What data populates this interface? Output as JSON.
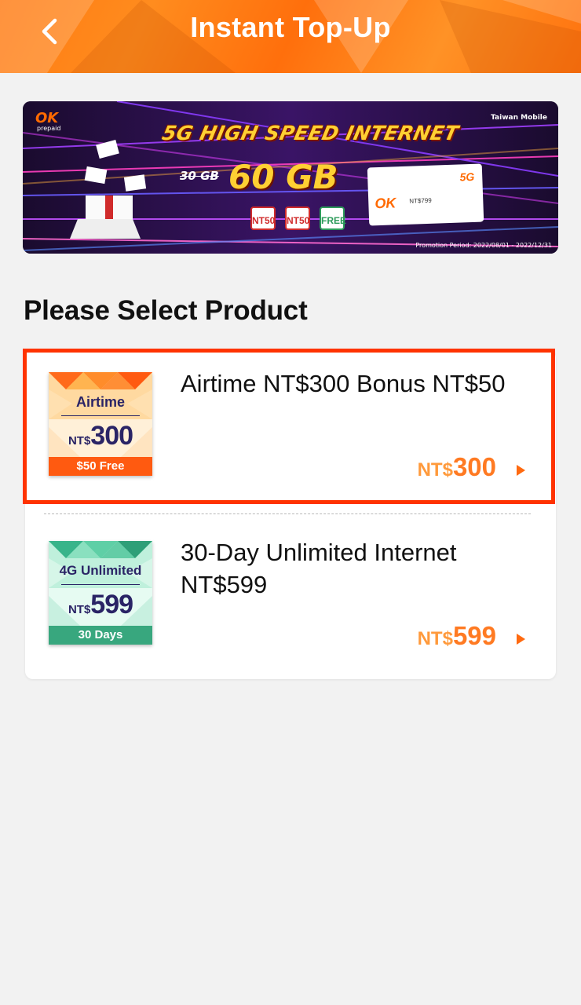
{
  "header": {
    "title": "Instant Top-Up",
    "back_icon": "chevron-left-icon",
    "colors": {
      "background": "#ff7a12",
      "text": "#ffffff"
    }
  },
  "banner": {
    "logo_text": "OK",
    "logo_sub": "prepaid",
    "carrier": "Taiwan Mobile",
    "headline": "5G HIGH SPEED INTERNET",
    "old_amount": "30 GB",
    "new_amount": "60 GB",
    "badges": [
      "NT50",
      "NT50",
      "FREE"
    ],
    "card_5g": "5G",
    "card_ok": "OK",
    "card_price": "NT$799",
    "promotion": "Promotion Period: 2022/08/01 - 2022/12/31"
  },
  "section_title": "Please Select Product",
  "products": [
    {
      "name": "Airtime NT$300 Bonus NT$50",
      "thumb_label": "Airtime",
      "thumb_currency": "NT$",
      "thumb_amount": "300",
      "thumb_footer": "$50 Free",
      "price_currency": "NT$",
      "price_amount": "300",
      "selected": true,
      "arrow_icon": "caret-right-icon"
    },
    {
      "name": "30-Day Unlimited Internet NT$599",
      "thumb_label": "4G Unlimited",
      "thumb_currency": "NT$",
      "thumb_amount": "599",
      "thumb_footer": "30 Days",
      "price_currency": "NT$",
      "price_amount": "599",
      "selected": false,
      "arrow_icon": "caret-right-icon"
    }
  ],
  "colors": {
    "accent": "#ff7a22",
    "highlight_border": "#ff3300",
    "page_background": "#f2f2f2"
  }
}
